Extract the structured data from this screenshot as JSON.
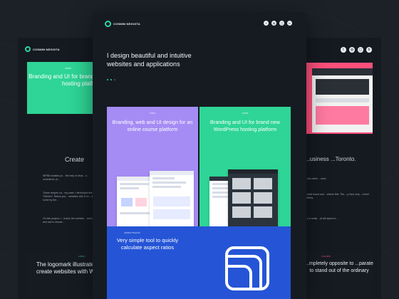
{
  "brand": {
    "name": "COSMIN NEGOITA",
    "accent": "#2fd6a0"
  },
  "social_icons": [
    "twitter-icon",
    "dribbble-icon",
    "instagram-icon",
    "behance-icon"
  ],
  "center": {
    "hero": "I design beautiful and intuitive websites and applications",
    "tiles": [
      {
        "tag": "TEBO",
        "title": "Branding, web and UI design for an online course platform",
        "color": "#a58cf5"
      },
      {
        "tag": "WPB8",
        "title": "Branding and UI for brand new WordPress hosting platform",
        "color": "#2ed596"
      },
      {
        "tag": "ASPECTOSAUR",
        "title": "Very simple tool to quickly calculate aspect ratios",
        "color": "#2555d6"
      }
    ]
  },
  "left": {
    "card_tag": "WPB8",
    "card_title": "Branding and UI for brand new WordPress hosting platform",
    "section_title": "Create",
    "paragraphs": [
      "WPB8 enables yo... the help of what... e-commerce, pl...",
      "Those recipes ca... my case, I developed the... \"Kitchen\". Below you... websites with it on... and some by the...",
      "On this project, I... brand, the website... and UI... and use to shows..."
    ],
    "bottom_tag": "LOGO",
    "bottom_title": "The logomark illustrates the speed you create websites with WP..."
  },
  "right": {
    "section_title": "...usiness ...Toronto.",
    "paragraphs": [
      "...ont online ...nces.",
      "...acial brand and ...chieve this. The ...y, thus very ...d well entirely.",
      "...ir a really ...at will spend a ..."
    ],
    "bottom_tag": "COLORS",
    "bottom_title": "...mpletely opposite to ...parate to stand out of the ordinary"
  }
}
